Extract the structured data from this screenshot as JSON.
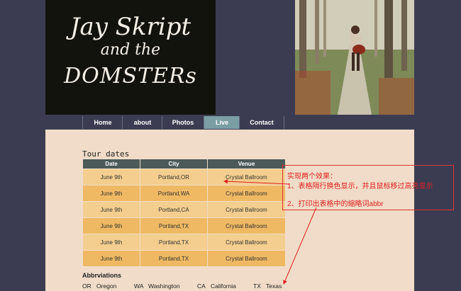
{
  "header": {
    "line1": "Jay Skript",
    "line2": "and the",
    "line3": "DOMSTERs"
  },
  "nav": [
    {
      "label": "Home"
    },
    {
      "label": "about"
    },
    {
      "label": "Photos"
    },
    {
      "label": "Live"
    },
    {
      "label": "Contact"
    }
  ],
  "tour": {
    "title": "Tour dates",
    "headers": [
      "Date",
      "City",
      "Venue"
    ],
    "rows": [
      [
        "June 9th",
        "Portland,OR",
        "Crystal Ballroom"
      ],
      [
        "June 9th",
        "Portland,WA",
        "Crystal Ballroom"
      ],
      [
        "June 9th",
        "Portland,CA",
        "Crystal Ballroom"
      ],
      [
        "June 9th",
        "Portland,TX",
        "Crystal Ballroom"
      ],
      [
        "June 9th",
        "Portland,TX",
        "Crystal Ballroom"
      ],
      [
        "June 9th",
        "Portland,TX",
        "Crystal Ballroom"
      ]
    ]
  },
  "abbreviations": {
    "title": "Abbrviations",
    "items": [
      {
        "abbr": "OR",
        "full": "Oregon"
      },
      {
        "abbr": "WA",
        "full": "Washington"
      },
      {
        "abbr": "CA",
        "full": "California"
      },
      {
        "abbr": "TX",
        "full": "Texas"
      }
    ]
  },
  "annotation": {
    "line1": "实现两个效果：",
    "line2": "1、表格隔行换色显示，并且鼠标移过高亮显示",
    "line3": "2、打印出表格中的缩略词abbr",
    "color": "#e02020"
  }
}
